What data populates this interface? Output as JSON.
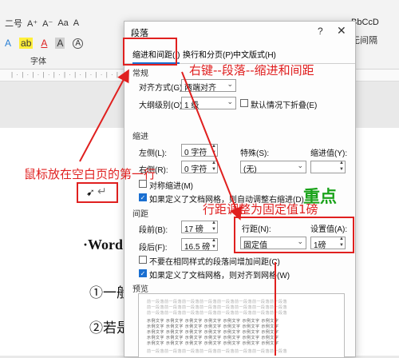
{
  "ribbon": {
    "row1_items": [
      "二号",
      "A⁺",
      "A⁻",
      "Aa",
      "A"
    ],
    "row2_items": [
      "A",
      "ab",
      "A",
      "A",
      "A"
    ],
    "group_label": "字体",
    "style_preview": "BbCcD",
    "style_name": "无间隔"
  },
  "document": {
    "cursor_marker": "↵",
    "line1": "·Word",
    "line2": "①一般",
    "line3": "②若是"
  },
  "annotations": {
    "mouse_note": "鼠标放在空白页的第一行",
    "right_click_note": "右键--段落--缩进和间距",
    "key_point": "重点",
    "line_spacing_note": "行距调整为固定值1磅"
  },
  "dialog": {
    "title": "段落",
    "help": "?",
    "close": "✕",
    "tabs": [
      "缩进和间距(I)",
      "换行和分页(P)",
      "中文版式(H)"
    ],
    "general": {
      "section": "常规",
      "alignment_label": "对齐方式(G):",
      "alignment_value": "两端对齐",
      "outline_label": "大纲级别(O):",
      "outline_value": "1 级",
      "collapsed_label": "默认情况下折叠(E)"
    },
    "indent": {
      "section": "缩进",
      "left_label": "左侧(L):",
      "left_value": "0 字符",
      "right_label": "右侧(R):",
      "right_value": "0 字符",
      "special_label": "特殊(S):",
      "special_value": "(无)",
      "indent_value_label": "缩进值(Y):",
      "indent_value": "",
      "mirror_label": "对称缩进(M)",
      "auto_adjust_label": "如果定义了文档网格，则自动调整右缩进(D)"
    },
    "spacing": {
      "section": "间距",
      "before_label": "段前(B):",
      "before_value": "17 磅",
      "after_label": "段后(F):",
      "after_value": "16.5 磅",
      "line_spacing_label": "行距(N):",
      "line_spacing_value": "固定值",
      "at_label": "设置值(A):",
      "at_value": "1磅",
      "no_space_label": "不要在相同样式的段落间增加间距(C)",
      "snap_grid_label": "如果定义了文档网格，则对齐到网格(W)"
    },
    "preview": {
      "section": "预览",
      "prev_text": "前一段落前一段落前一段落前一段落前一段落前一段落前一段落前一段落",
      "sample_text": "示例文字 示例文字 示例文字 示例文字 示例文字 示例文字 示例文字"
    }
  }
}
